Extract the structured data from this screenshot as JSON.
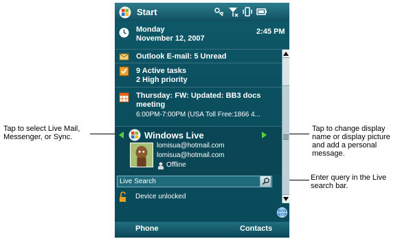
{
  "callouts": {
    "left": "Tap to select Live Mail, Messenger, or Sync.",
    "right_top": "Tap to change display name or display picture and add a personal message.",
    "right_bottom": "Enter query in the Live search bar."
  },
  "titlebar": {
    "start_label": "Start",
    "icons": [
      "connectivity-icon",
      "signal-icon",
      "vibrate-icon",
      "battery-icon"
    ]
  },
  "date": {
    "day": "Monday",
    "date": "November 12, 2007",
    "time": "2:45 PM"
  },
  "email": {
    "text": "Outlook E-mail: 5 Unread"
  },
  "tasks": {
    "line1": "9 Active tasks",
    "line2": "2 High priority"
  },
  "calendar": {
    "line1": "Thursday: FW: Updated: BB3 docs",
    "line2": "meeting",
    "line3": "6:00PM-7:00PM (USA Toll Free:1866 4..."
  },
  "live": {
    "title": "Windows Live",
    "email1": "lomisua@hotmail.com",
    "email2": "lomisua@hotmail.com",
    "status": "Offline"
  },
  "search": {
    "label": "Live Search"
  },
  "device": {
    "text": "Device unlocked"
  },
  "softkeys": {
    "left": "Phone",
    "right": "Contacts"
  },
  "colors": {
    "screen_bg": "#0b4f5f",
    "accent_green": "#52d33a"
  }
}
